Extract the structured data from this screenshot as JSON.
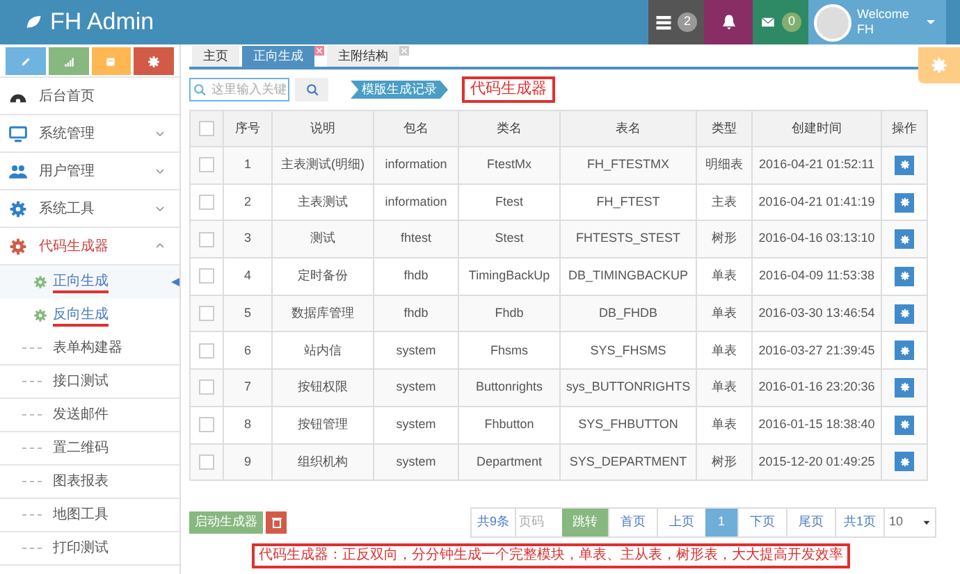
{
  "brand": "FH Admin",
  "topbar": {
    "tasks_count": "2",
    "messages_count": "0",
    "welcome": "Welcome",
    "user": "FH"
  },
  "sidebar": {
    "items": [
      {
        "label": "后台首页",
        "kind": "menu",
        "expandable": false,
        "expanded": false
      },
      {
        "label": "系统管理",
        "kind": "menu",
        "expandable": true,
        "expanded": false
      },
      {
        "label": "用户管理",
        "kind": "menu",
        "expandable": true,
        "expanded": false
      },
      {
        "label": "系统工具",
        "kind": "menu",
        "expandable": true,
        "expanded": false
      },
      {
        "label": "代码生成器",
        "kind": "menu",
        "expandable": true,
        "expanded": true,
        "children": [
          {
            "label": "正向生成",
            "selected": true
          },
          {
            "label": "反向生成",
            "selected": false
          }
        ]
      },
      {
        "label": "表单构建器",
        "kind": "leaf"
      },
      {
        "label": "接口测试",
        "kind": "leaf"
      },
      {
        "label": "发送邮件",
        "kind": "leaf"
      },
      {
        "label": "置二维码",
        "kind": "leaf"
      },
      {
        "label": "图表报表",
        "kind": "leaf"
      },
      {
        "label": "地图工具",
        "kind": "leaf"
      },
      {
        "label": "打印测试",
        "kind": "leaf"
      }
    ]
  },
  "tabs": [
    {
      "label": "主页",
      "selected": false,
      "closable": false
    },
    {
      "label": "正向生成",
      "selected": true,
      "closable": true
    },
    {
      "label": "主附结构",
      "selected": false,
      "closable": true
    }
  ],
  "search": {
    "placeholder": "这里输入关键"
  },
  "history_button": "模版生成记录",
  "title_annotation": "代码生成器",
  "table": {
    "all_checked": false,
    "columns": [
      "序号",
      "说明",
      "包名",
      "类名",
      "表名",
      "类型",
      "创建时间",
      "操作"
    ],
    "rows": [
      {
        "checked": false,
        "cells": [
          "1",
          "主表测试(明细)",
          "information",
          "FtestMx",
          "FH_FTESTMX",
          "明细表",
          "2016-04-21 01:52:11"
        ]
      },
      {
        "checked": false,
        "cells": [
          "2",
          "主表测试",
          "information",
          "Ftest",
          "FH_FTEST",
          "主表",
          "2016-04-21 01:41:19"
        ]
      },
      {
        "checked": false,
        "cells": [
          "3",
          "测试",
          "fhtest",
          "Stest",
          "FHTESTS_STEST",
          "树形",
          "2016-04-16 03:13:10"
        ]
      },
      {
        "checked": false,
        "cells": [
          "4",
          "定时备份",
          "fhdb",
          "TimingBackUp",
          "DB_TIMINGBACKUP",
          "单表",
          "2016-04-09 11:53:38"
        ]
      },
      {
        "checked": false,
        "cells": [
          "5",
          "数据库管理",
          "fhdb",
          "Fhdb",
          "DB_FHDB",
          "单表",
          "2016-03-30 13:46:54"
        ]
      },
      {
        "checked": false,
        "cells": [
          "6",
          "站内信",
          "system",
          "Fhsms",
          "SYS_FHSMS",
          "单表",
          "2016-03-27 21:39:45"
        ]
      },
      {
        "checked": false,
        "cells": [
          "7",
          "按钮权限",
          "system",
          "Buttonrights",
          "sys_BUTTONRIGHTS",
          "单表",
          "2016-01-16 23:20:36"
        ]
      },
      {
        "checked": false,
        "cells": [
          "8",
          "按钮管理",
          "system",
          "Fhbutton",
          "SYS_FHBUTTON",
          "单表",
          "2016-01-15 18:38:40"
        ]
      },
      {
        "checked": false,
        "cells": [
          "9",
          "组织机构",
          "system",
          "Department",
          "SYS_DEPARTMENT",
          "树形",
          "2015-12-20 01:49:25"
        ]
      }
    ]
  },
  "start_button": "启动生成器",
  "pagination": {
    "total": "共9条",
    "page_input_placeholder": "页码",
    "jump": "跳转",
    "first": "首页",
    "prev": "上页",
    "current": "1",
    "next": "下页",
    "last": "尾页",
    "pages": "共1页",
    "page_size": "10"
  },
  "caption_annotation": "代码生成器：正反双向，分分钟生成一个完整模块，单表、主从表，树形表，大大提高开发效率"
}
